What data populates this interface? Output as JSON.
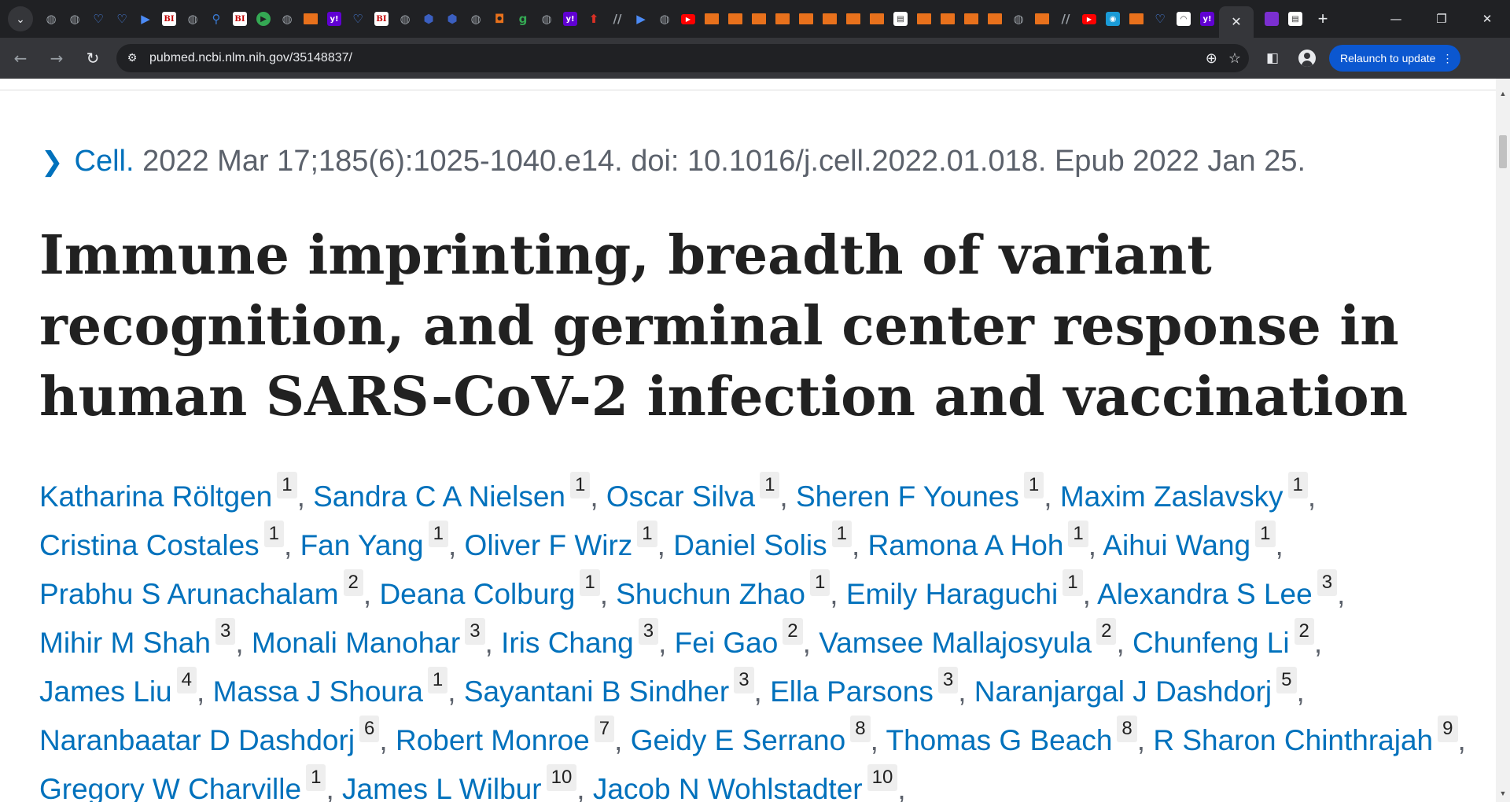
{
  "browser": {
    "tab_search_icon": "chevron-down-icon",
    "favicons": [
      {
        "name": "globe",
        "color": "#9aa0a6",
        "glyph": "◍"
      },
      {
        "name": "globe",
        "color": "#9aa0a6",
        "glyph": "◍"
      },
      {
        "name": "shield",
        "color": "#4c8bf5",
        "glyph": "♡"
      },
      {
        "name": "shield",
        "color": "#4c8bf5",
        "glyph": "♡"
      },
      {
        "name": "arrow",
        "color": "#4c8bf5",
        "glyph": "▶"
      },
      {
        "name": "bi",
        "color": "#c00000",
        "glyph": "BI"
      },
      {
        "name": "globe",
        "color": "#9aa0a6",
        "glyph": "◍"
      },
      {
        "name": "search",
        "color": "#3a7bd5",
        "glyph": "⚲"
      },
      {
        "name": "bi",
        "color": "#c00000",
        "glyph": "BI"
      },
      {
        "name": "play",
        "color": "#34a853",
        "glyph": "▶"
      },
      {
        "name": "globe",
        "color": "#9aa0a6",
        "glyph": "◍"
      },
      {
        "name": "bookmark",
        "color": "#e8711c",
        "glyph": "▬"
      },
      {
        "name": "yahoo",
        "color": "#6001d2",
        "glyph": "y!"
      },
      {
        "name": "shield",
        "color": "#4c8bf5",
        "glyph": "♡"
      },
      {
        "name": "bi",
        "color": "#c00000",
        "glyph": "BI"
      },
      {
        "name": "globe",
        "color": "#9aa0a6",
        "glyph": "◍"
      },
      {
        "name": "cube",
        "color": "#3b5fc0",
        "glyph": "⬢"
      },
      {
        "name": "cube",
        "color": "#3b5fc0",
        "glyph": "⬢"
      },
      {
        "name": "globe",
        "color": "#9aa0a6",
        "glyph": "◍"
      },
      {
        "name": "shield",
        "color": "#e8711c",
        "glyph": "◘"
      },
      {
        "name": "g",
        "color": "#34a853",
        "glyph": "g"
      },
      {
        "name": "globe",
        "color": "#9aa0a6",
        "glyph": "◍"
      },
      {
        "name": "yahoo",
        "color": "#6001d2",
        "glyph": "y!"
      },
      {
        "name": "red",
        "color": "#d93025",
        "glyph": "⬆"
      },
      {
        "name": "slash",
        "color": "#9aa0a6",
        "glyph": "//"
      },
      {
        "name": "arrow",
        "color": "#4c8bf5",
        "glyph": "▶"
      },
      {
        "name": "globe",
        "color": "#9aa0a6",
        "glyph": "◍"
      },
      {
        "name": "youtube",
        "color": "#ff0000",
        "glyph": "▶"
      },
      {
        "name": "bookmark",
        "color": "#e8711c",
        "glyph": "▬"
      },
      {
        "name": "bookmark",
        "color": "#e8711c",
        "glyph": "▬"
      },
      {
        "name": "bookmark",
        "color": "#e8711c",
        "glyph": "▬"
      },
      {
        "name": "bookmark",
        "color": "#e8711c",
        "glyph": "▬"
      },
      {
        "name": "bookmark",
        "color": "#e8711c",
        "glyph": "▬"
      },
      {
        "name": "bookmark",
        "color": "#e8711c",
        "glyph": "▬"
      },
      {
        "name": "bookmark",
        "color": "#e8711c",
        "glyph": "▬"
      },
      {
        "name": "bookmark",
        "color": "#e8711c",
        "glyph": "▬"
      },
      {
        "name": "doc",
        "color": "#dddddd",
        "glyph": "▤"
      },
      {
        "name": "bookmark",
        "color": "#e8711c",
        "glyph": "▬"
      },
      {
        "name": "bookmark",
        "color": "#e8711c",
        "glyph": "▬"
      },
      {
        "name": "bookmark",
        "color": "#e8711c",
        "glyph": "▬"
      },
      {
        "name": "bookmark",
        "color": "#e8711c",
        "glyph": "▬"
      },
      {
        "name": "globe",
        "color": "#9aa0a6",
        "glyph": "◍"
      },
      {
        "name": "bookmark",
        "color": "#e8711c",
        "glyph": "▬"
      },
      {
        "name": "slash",
        "color": "#9aa0a6",
        "glyph": "//"
      },
      {
        "name": "youtube",
        "color": "#ff0000",
        "glyph": "▶"
      },
      {
        "name": "app",
        "color": "#1a9bd7",
        "glyph": "◉"
      },
      {
        "name": "bookmark",
        "color": "#e8711c",
        "glyph": "▬"
      },
      {
        "name": "shield",
        "color": "#4c8bf5",
        "glyph": "♡"
      },
      {
        "name": "arc",
        "color": "#ffffff",
        "glyph": "◠"
      },
      {
        "name": "yahoo",
        "color": "#6001d2",
        "glyph": "y!"
      }
    ],
    "active_tab_close": "✕",
    "after_active": [
      {
        "name": "purple",
        "color": "#7b2fd0",
        "glyph": "▬"
      },
      {
        "name": "doc",
        "color": "#dddddd",
        "glyph": "▤"
      }
    ],
    "new_tab": "+",
    "window": {
      "minimize": "—",
      "restore": "❐",
      "close": "✕"
    },
    "url": "pubmed.ncbi.nlm.nih.gov/35148837/",
    "relaunch_label": "Relaunch to update",
    "colors": {
      "tabstrip": "#202124",
      "toolbar": "#35363a",
      "relaunch": "#0b57d0"
    }
  },
  "article": {
    "journal": "Cell.",
    "citation_rest": "2022 Mar 17;185(6):1025-1040.e14. doi: 10.1016/j.cell.2022.01.018. Epub 2022 Jan 25.",
    "title": "Immune imprinting, breadth of variant recognition, and germinal center response in human SARS-CoV-2 infection and vaccination",
    "authors": [
      {
        "name": "Katharina Röltgen",
        "aff": "1"
      },
      {
        "name": "Sandra C A Nielsen",
        "aff": "1"
      },
      {
        "name": "Oscar Silva",
        "aff": "1"
      },
      {
        "name": "Sheren F Younes",
        "aff": "1"
      },
      {
        "name": "Maxim Zaslavsky",
        "aff": "1"
      },
      {
        "name": "Cristina Costales",
        "aff": "1"
      },
      {
        "name": "Fan Yang",
        "aff": "1"
      },
      {
        "name": "Oliver F Wirz",
        "aff": "1"
      },
      {
        "name": "Daniel Solis",
        "aff": "1"
      },
      {
        "name": "Ramona A Hoh",
        "aff": "1"
      },
      {
        "name": "Aihui Wang",
        "aff": "1"
      },
      {
        "name": "Prabhu S Arunachalam",
        "aff": "2"
      },
      {
        "name": "Deana Colburg",
        "aff": "1"
      },
      {
        "name": "Shuchun Zhao",
        "aff": "1"
      },
      {
        "name": "Emily Haraguchi",
        "aff": "1"
      },
      {
        "name": "Alexandra S Lee",
        "aff": "3"
      },
      {
        "name": "Mihir M Shah",
        "aff": "3"
      },
      {
        "name": "Monali Manohar",
        "aff": "3"
      },
      {
        "name": "Iris Chang",
        "aff": "3"
      },
      {
        "name": "Fei Gao",
        "aff": "2"
      },
      {
        "name": "Vamsee Mallajosyula",
        "aff": "2"
      },
      {
        "name": "Chunfeng Li",
        "aff": "2"
      },
      {
        "name": "James Liu",
        "aff": "4"
      },
      {
        "name": "Massa J Shoura",
        "aff": "1"
      },
      {
        "name": "Sayantani B Sindher",
        "aff": "3"
      },
      {
        "name": "Ella Parsons",
        "aff": "3"
      },
      {
        "name": "Naranjargal J Dashdorj",
        "aff": "5"
      },
      {
        "name": "Naranbaatar D Dashdorj",
        "aff": "6"
      },
      {
        "name": "Robert Monroe",
        "aff": "7"
      },
      {
        "name": "Geidy E Serrano",
        "aff": "8"
      },
      {
        "name": "Thomas G Beach",
        "aff": "8"
      },
      {
        "name": "R Sharon Chinthrajah",
        "aff": "9"
      },
      {
        "name": "Gregory W Charville",
        "aff": "1"
      },
      {
        "name": "James L Wilbur",
        "aff": "10"
      },
      {
        "name": "Jacob N Wohlstadter",
        "aff": "10"
      }
    ],
    "colors": {
      "link": "#0071bc",
      "title": "#212121",
      "meta": "#5b616b"
    }
  }
}
